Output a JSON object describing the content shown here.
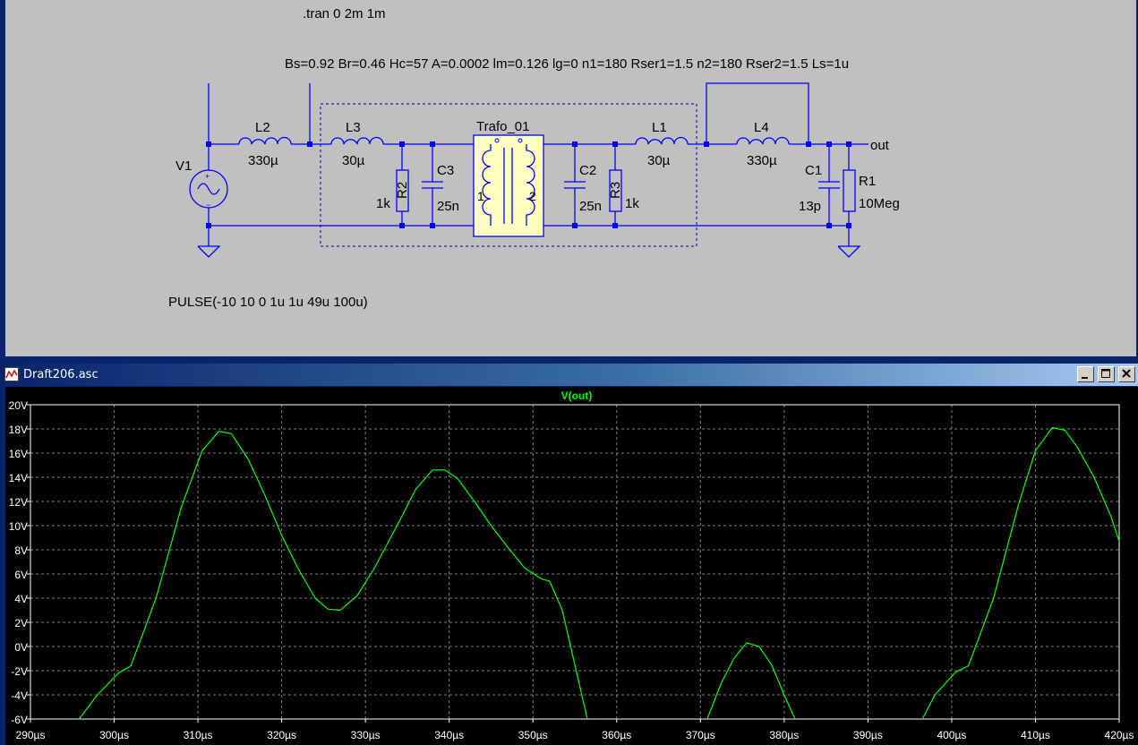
{
  "schematic": {
    "tran_directive": ".tran 0 2m 1m",
    "model_params": "Bs=0.92 Br=0.46 Hc=57 A=0.0002 lm=0.126 lg=0 n1=180 Rser1=1.5  n2=180 Rser2=1.5 Ls=1u",
    "pulse_source": "PULSE(-10 10 0 1u 1u 49u 100u)",
    "components": {
      "V1": {
        "name": "V1"
      },
      "L2": {
        "name": "L2",
        "value": "330µ"
      },
      "L3": {
        "name": "L3",
        "value": "30µ"
      },
      "R2": {
        "name": "R2",
        "value": "1k"
      },
      "C3": {
        "name": "C3",
        "value": "25n"
      },
      "Trafo": {
        "name": "Trafo_01",
        "pin1": "1",
        "pin2": "2"
      },
      "C2": {
        "name": "C2",
        "value": "25n"
      },
      "R3": {
        "name": "R3",
        "value": "1k"
      },
      "L1": {
        "name": "L1",
        "value": "30µ"
      },
      "L4": {
        "name": "L4",
        "value": "330µ"
      },
      "C1": {
        "name": "C1",
        "value": "13p"
      },
      "R1": {
        "name": "R1",
        "value": "10Meg"
      },
      "out_label": "out"
    },
    "colors": {
      "wire": "#0000ff",
      "background": "#c0c0c0",
      "trafo_fill": "#ffffc0"
    }
  },
  "plot_window": {
    "title": "Draft206.asc",
    "buttons": {
      "minimize": "minimize-icon",
      "maximize": "maximize-icon",
      "close": "close-icon"
    }
  },
  "chart_data": {
    "type": "line",
    "title": "V(out)",
    "xlabel": "",
    "ylabel": "",
    "xlim": [
      290,
      420
    ],
    "ylim": [
      -6,
      20
    ],
    "x_ticks": [
      "290µs",
      "300µs",
      "310µs",
      "320µs",
      "330µs",
      "340µs",
      "350µs",
      "360µs",
      "370µs",
      "380µs",
      "390µs",
      "400µs",
      "410µs",
      "420µs"
    ],
    "y_ticks": [
      "20V",
      "18V",
      "16V",
      "14V",
      "12V",
      "10V",
      "8V",
      "6V",
      "4V",
      "2V",
      "0V",
      "-2V",
      "-4V",
      "-6V"
    ],
    "grid": true,
    "trace_color": "#00ff00",
    "series": [
      {
        "name": "V(out)",
        "segments": [
          [
            [
              295.8,
              -6
            ],
            [
              298,
              -4
            ],
            [
              300.5,
              -2.2
            ],
            [
              302,
              -1.6
            ],
            [
              305,
              4
            ],
            [
              308,
              11.5
            ],
            [
              310.5,
              16.2
            ],
            [
              312.5,
              17.8
            ],
            [
              314,
              17.6
            ],
            [
              316,
              15.5
            ],
            [
              318,
              12.5
            ],
            [
              320,
              9.2
            ],
            [
              322,
              6.4
            ],
            [
              324,
              4
            ],
            [
              325.5,
              3.1
            ],
            [
              327,
              3
            ],
            [
              329,
              4.2
            ],
            [
              331,
              6.4
            ],
            [
              334,
              10.3
            ],
            [
              336,
              13
            ],
            [
              338,
              14.6
            ],
            [
              339.5,
              14.6
            ],
            [
              341,
              13.9
            ],
            [
              343,
              12
            ],
            [
              345,
              10
            ],
            [
              347,
              8.2
            ],
            [
              349,
              6.5
            ],
            [
              351,
              5.6
            ],
            [
              352,
              5.4
            ],
            [
              353.5,
              3
            ],
            [
              355,
              -1.5
            ],
            [
              356.5,
              -6
            ]
          ],
          [
            [
              370.8,
              -6
            ],
            [
              372.5,
              -3
            ],
            [
              374,
              -1
            ],
            [
              375.5,
              0.3
            ],
            [
              377,
              0
            ],
            [
              378.5,
              -1.5
            ],
            [
              380,
              -4
            ],
            [
              381.3,
              -6
            ]
          ],
          [
            [
              396.5,
              -6
            ],
            [
              398,
              -4
            ],
            [
              400.5,
              -2.1
            ],
            [
              402,
              -1.6
            ],
            [
              405,
              4
            ],
            [
              408,
              11.8
            ],
            [
              410,
              16.2
            ],
            [
              412,
              18.1
            ],
            [
              413.5,
              17.9
            ],
            [
              415,
              16.5
            ],
            [
              417,
              14
            ],
            [
              419,
              10.8
            ],
            [
              420,
              8.7
            ]
          ]
        ]
      }
    ]
  }
}
